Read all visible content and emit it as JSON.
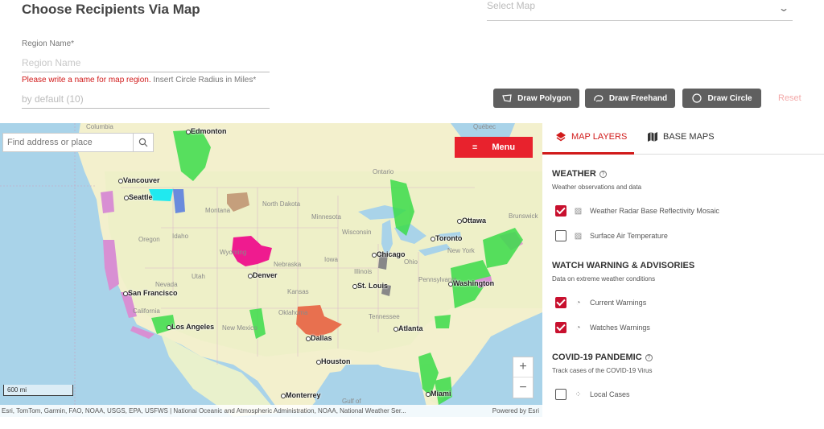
{
  "header": {
    "title": "Choose Recipients Via Map"
  },
  "select_map": {
    "placeholder": "Select Map"
  },
  "form": {
    "region_label": "Region Name*",
    "region_placeholder": "Region Name",
    "region_error": "Please write a name for map region.",
    "radius_label": "Insert Circle Radius in Miles*",
    "radius_placeholder": "by default (10)"
  },
  "toolbar": {
    "draw_polygon": "Draw Polygon",
    "draw_freehand": "Draw Freehand",
    "draw_circle": "Draw Circle",
    "reset": "Reset"
  },
  "map": {
    "search_placeholder": "Find address or place",
    "menu_label": "Menu",
    "zoom_in": "+",
    "zoom_out": "−",
    "scale": "600 mi",
    "attribution": "Esri, TomTom, Garmin, FAO, NOAA, USGS, EPA, USFWS | National Oceanic and Atmospheric Administration, NOAA, National Weather Ser...",
    "powered_by": "Powered by Esri",
    "cities": [
      {
        "name": "Edmonton"
      },
      {
        "name": "Vancouver"
      },
      {
        "name": "Seattle"
      },
      {
        "name": "Ottawa"
      },
      {
        "name": "Toronto"
      },
      {
        "name": "Chicago"
      },
      {
        "name": "Denver"
      },
      {
        "name": "St. Louis"
      },
      {
        "name": "Washington"
      },
      {
        "name": "San Francisco"
      },
      {
        "name": "Los Angeles"
      },
      {
        "name": "Dallas"
      },
      {
        "name": "Atlanta"
      },
      {
        "name": "Houston"
      },
      {
        "name": "Monterrey"
      },
      {
        "name": "Miami"
      }
    ],
    "region_labels": [
      {
        "name": "Columbia"
      },
      {
        "name": "Québec"
      },
      {
        "name": "Ontario"
      },
      {
        "name": "North Dakota"
      },
      {
        "name": "Montana"
      },
      {
        "name": "Minnesota"
      },
      {
        "name": "Wisconsin"
      },
      {
        "name": "Oregon"
      },
      {
        "name": "Idaho"
      },
      {
        "name": "Wyoming"
      },
      {
        "name": "Nebraska"
      },
      {
        "name": "Iowa"
      },
      {
        "name": "Illinois"
      },
      {
        "name": "Ohio"
      },
      {
        "name": "New York"
      },
      {
        "name": "Nevada"
      },
      {
        "name": "Utah"
      },
      {
        "name": "Kansas"
      },
      {
        "name": "California"
      },
      {
        "name": "Oklahoma"
      },
      {
        "name": "New Mexico"
      },
      {
        "name": "Tennessee"
      },
      {
        "name": "Gulf of"
      },
      {
        "name": "Brunswick"
      },
      {
        "name": "Pennsylvania"
      }
    ]
  },
  "panel": {
    "tabs": {
      "map_layers": "MAP LAYERS",
      "base_maps": "BASE MAPS"
    },
    "weather": {
      "title": "WEATHER",
      "desc": "Weather observations and data",
      "layers": [
        {
          "label": "Weather Radar Base Reflectivity Mosaic",
          "checked": true
        },
        {
          "label": "Surface Air Temperature",
          "checked": false
        }
      ]
    },
    "warnings": {
      "title": "WATCH WARNING & ADVISORIES",
      "desc": "Data on extreme weather conditions",
      "layers": [
        {
          "label": "Current Warnings",
          "checked": true
        },
        {
          "label": "Watches Warnings",
          "checked": true
        }
      ]
    },
    "covid": {
      "title": "COVID-19 PANDEMIC",
      "desc": "Track cases of the COVID-19 Virus",
      "layers": [
        {
          "label": "Local Cases",
          "checked": false
        }
      ]
    }
  },
  "colors": {
    "accent": "#d11a1a",
    "button": "#5f5f5f",
    "menu": "#e8222d"
  }
}
